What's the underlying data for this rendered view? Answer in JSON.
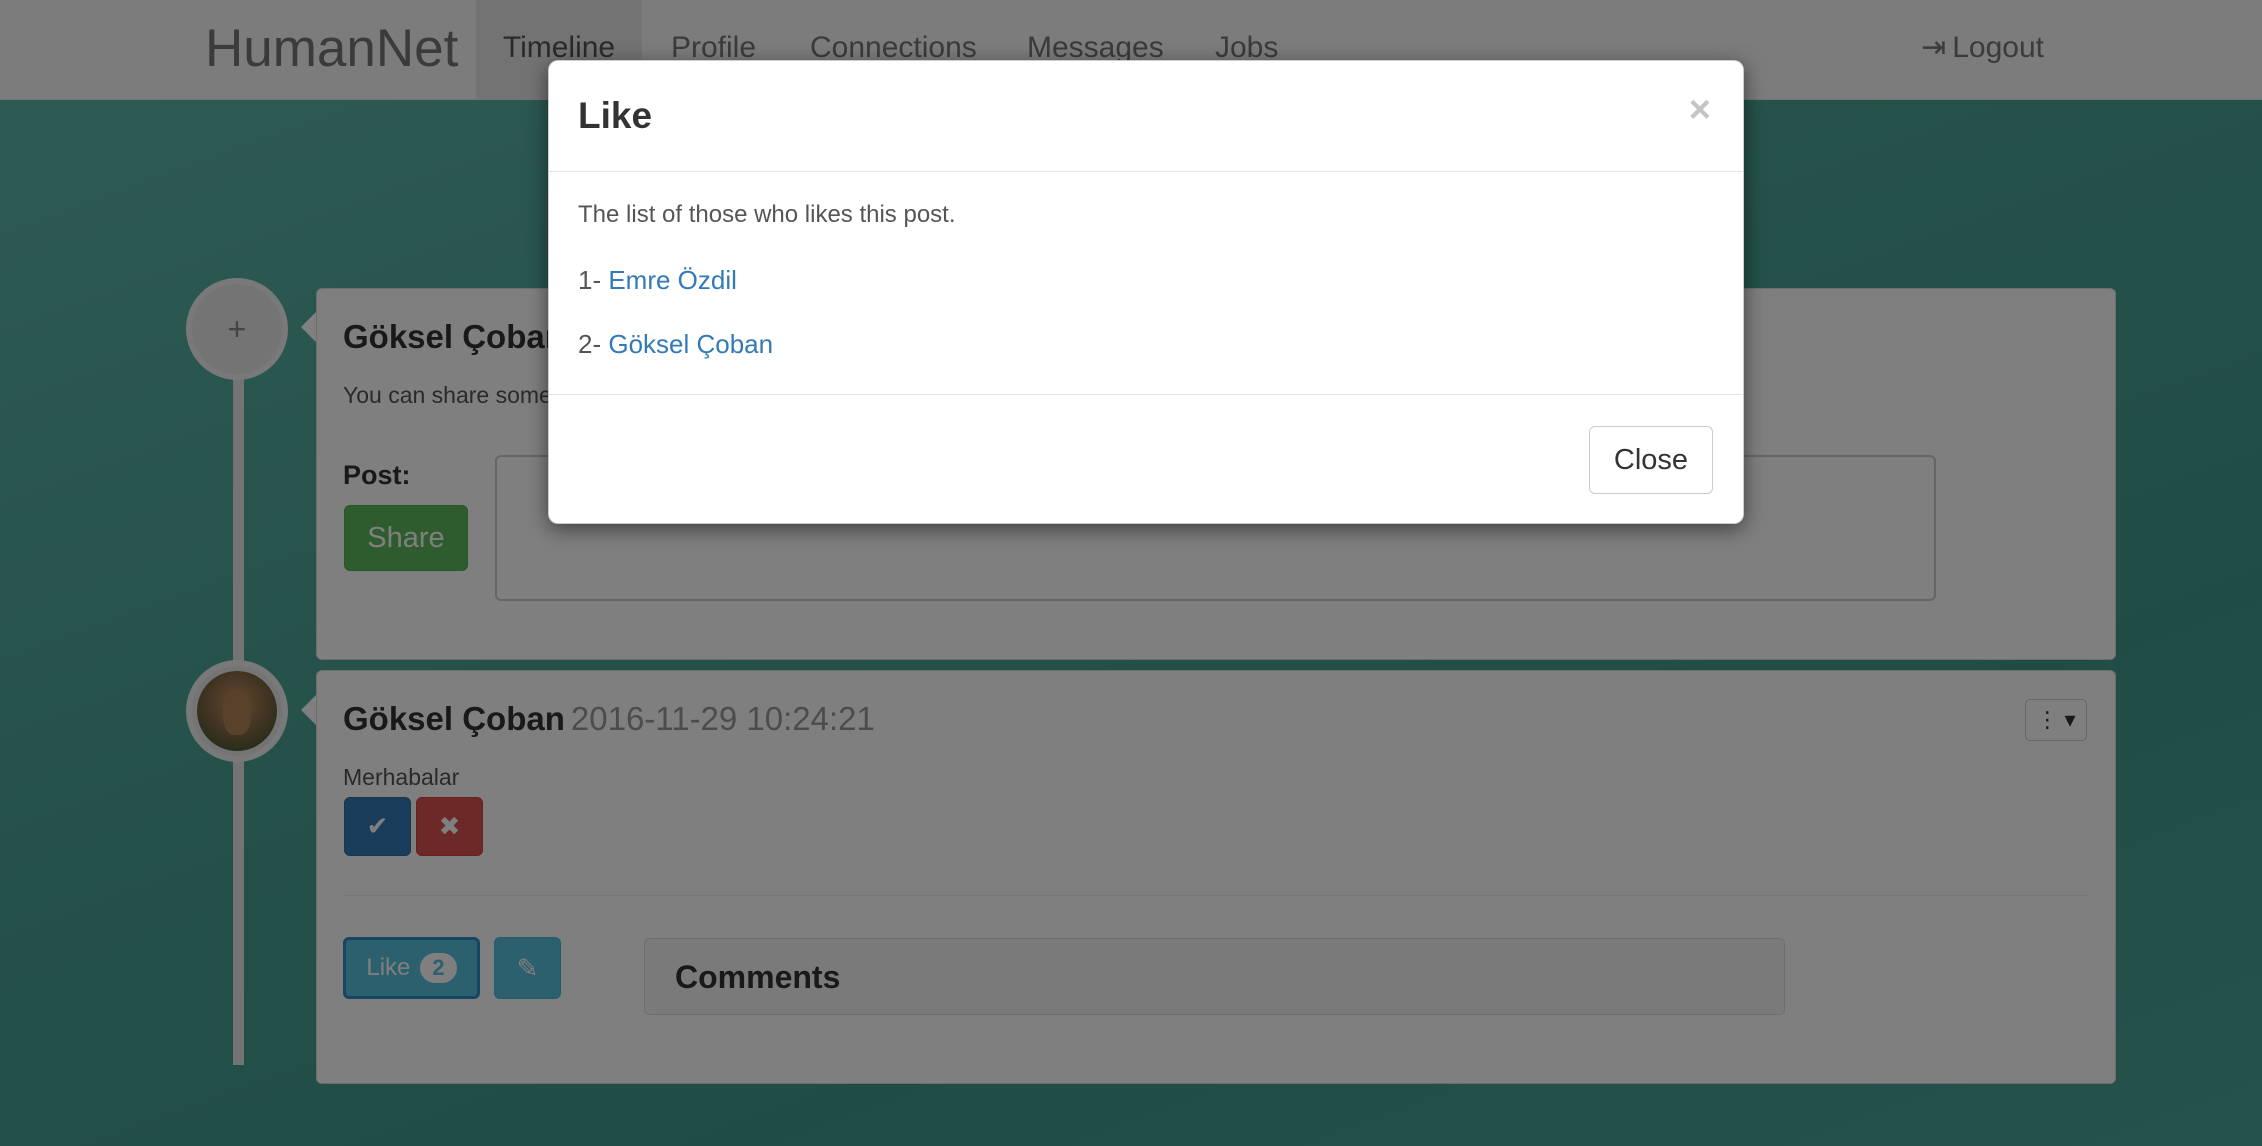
{
  "navbar": {
    "brand": "HumanNet",
    "items": [
      {
        "label": "Timeline",
        "active": true
      },
      {
        "label": "Profile"
      },
      {
        "label": "Connections"
      },
      {
        "label": "Messages"
      },
      {
        "label": "Jobs"
      }
    ],
    "logout": "Logout"
  },
  "composer": {
    "author": "Göksel Çoban",
    "hint": "You can share some",
    "post_label": "Post:",
    "share_label": "Share"
  },
  "post": {
    "author": "Göksel Çoban",
    "date": "2016-11-29 10:24:21",
    "text": "Merhabalar",
    "like_label": "Like",
    "like_count": "2",
    "comments_title": "Comments"
  },
  "modal": {
    "title": "Like",
    "close_x": "×",
    "description": "The list of those who likes this post.",
    "likers": [
      {
        "prefix": "1- ",
        "name": "Emre Özdil"
      },
      {
        "prefix": "2- ",
        "name": "Göksel Çoban"
      }
    ],
    "close_label": "Close"
  },
  "icons": {
    "plus": "+",
    "check": "✔",
    "cross": "✖",
    "edit": "✎",
    "more": "⋮ ▾",
    "logout": "⇥"
  }
}
